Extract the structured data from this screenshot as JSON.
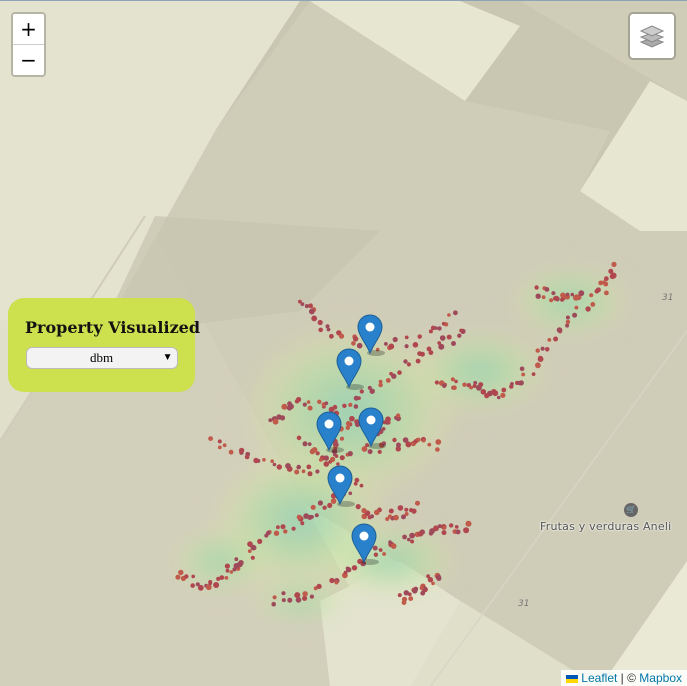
{
  "map": {
    "zoom_in_label": "+",
    "zoom_out_label": "−",
    "layers_icon": "layers-icon",
    "poi": {
      "icon": "shopping-cart-icon",
      "label": "Frutas y verduras Aneli"
    },
    "address_numbers": [
      "31",
      "31"
    ],
    "attribution": {
      "leaflet": "Leaflet",
      "separator": " | © ",
      "mapbox": "Mapbox"
    },
    "marker_count": 6,
    "colors": {
      "marker": "#2a81cb",
      "point": "#b0474e",
      "panel": "#cde04d",
      "building": "#cfccb8",
      "ground": "#e2e2cc"
    }
  },
  "panel": {
    "title": "Property Visualized",
    "select": {
      "selected": "dbm",
      "options": [
        "dbm"
      ]
    }
  }
}
